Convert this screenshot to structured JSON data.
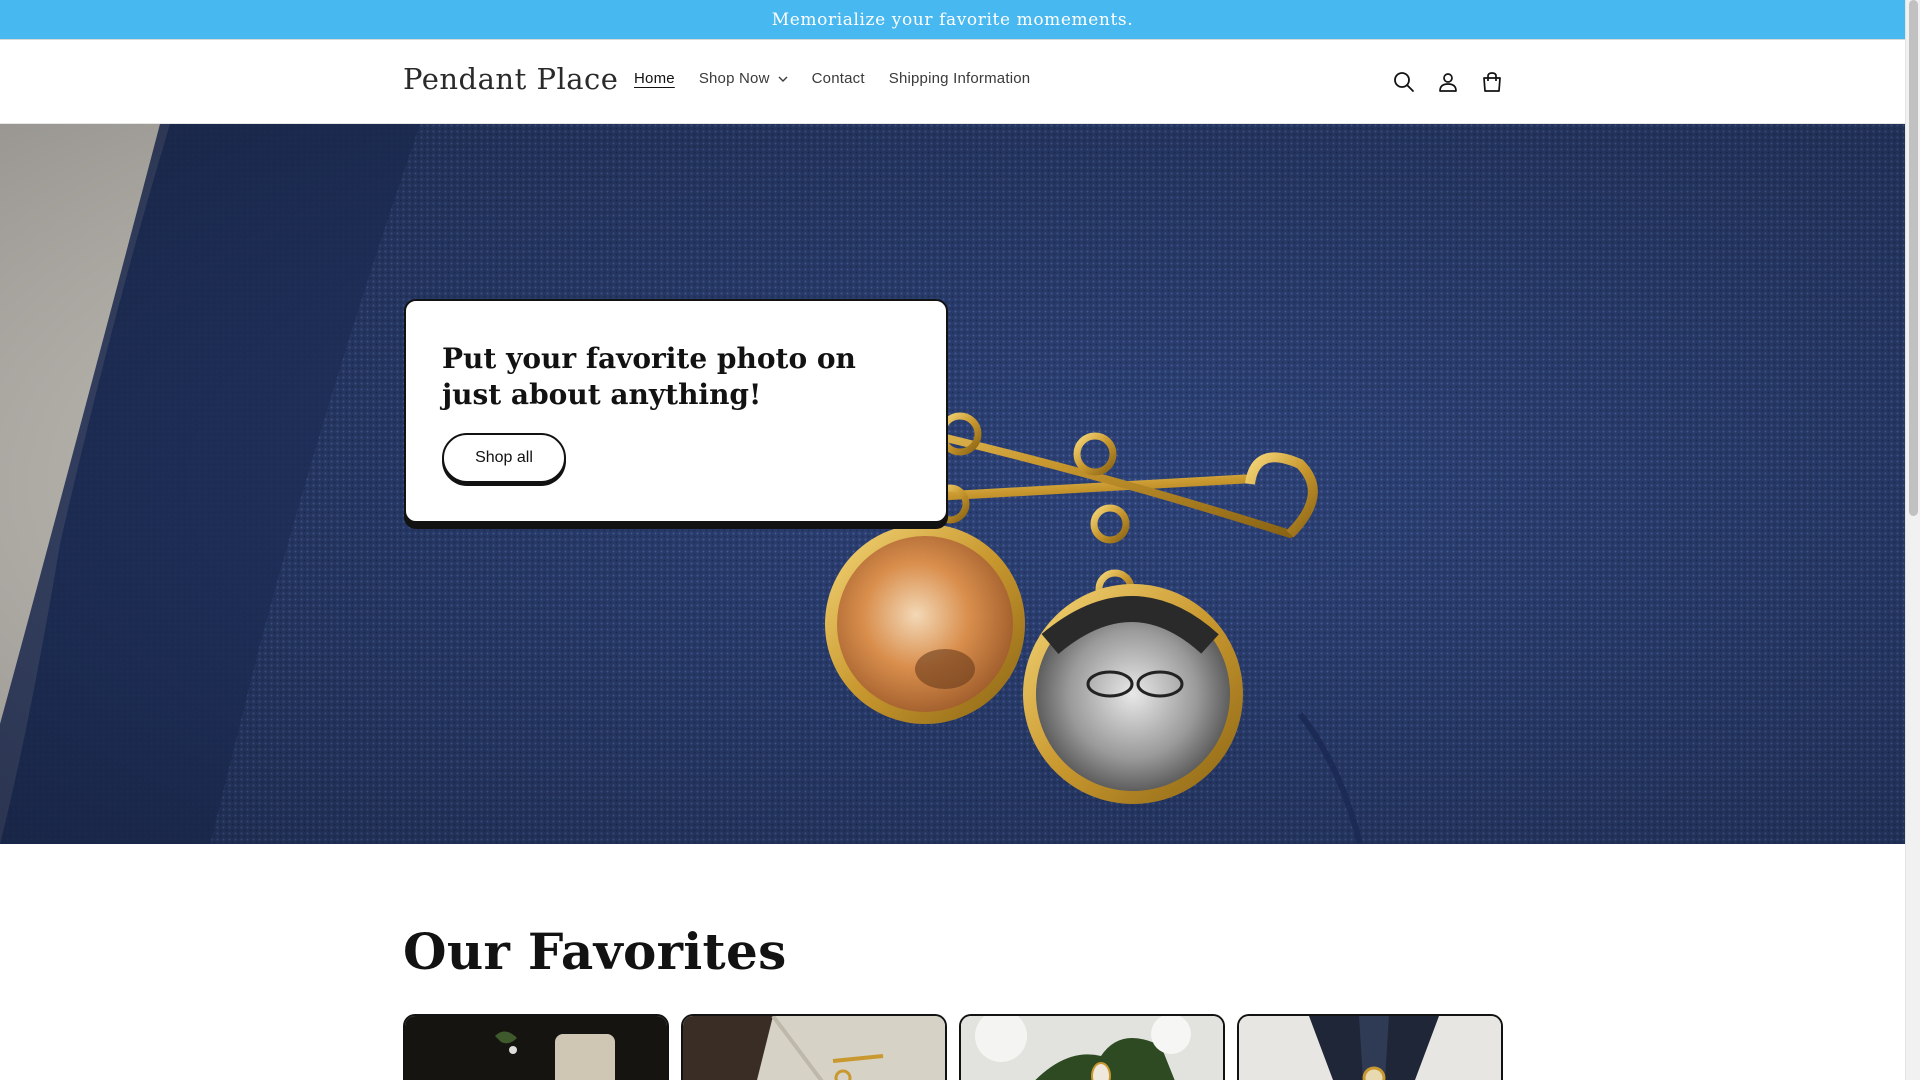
{
  "announcement": {
    "text": "Memorialize your favorite momements."
  },
  "header": {
    "logo": "Pendant Place",
    "nav": [
      {
        "label": "Home",
        "active": true
      },
      {
        "label": "Shop Now",
        "has_dropdown": true
      },
      {
        "label": "Contact"
      },
      {
        "label": "Shipping Information"
      }
    ],
    "icons": [
      "search-icon",
      "account-icon",
      "cart-icon"
    ]
  },
  "hero": {
    "title": "Put your favorite photo on just about anything!",
    "button_label": "Shop all"
  },
  "favorites": {
    "title": "Our Favorites",
    "cards": [
      "product-card-1",
      "product-card-2",
      "product-card-3",
      "product-card-4"
    ]
  },
  "colors": {
    "announcement_bg": "#48b8f0",
    "hero_fabric": "#2c3f74",
    "accent_gold": "#d4a63a",
    "text": "#121212"
  }
}
